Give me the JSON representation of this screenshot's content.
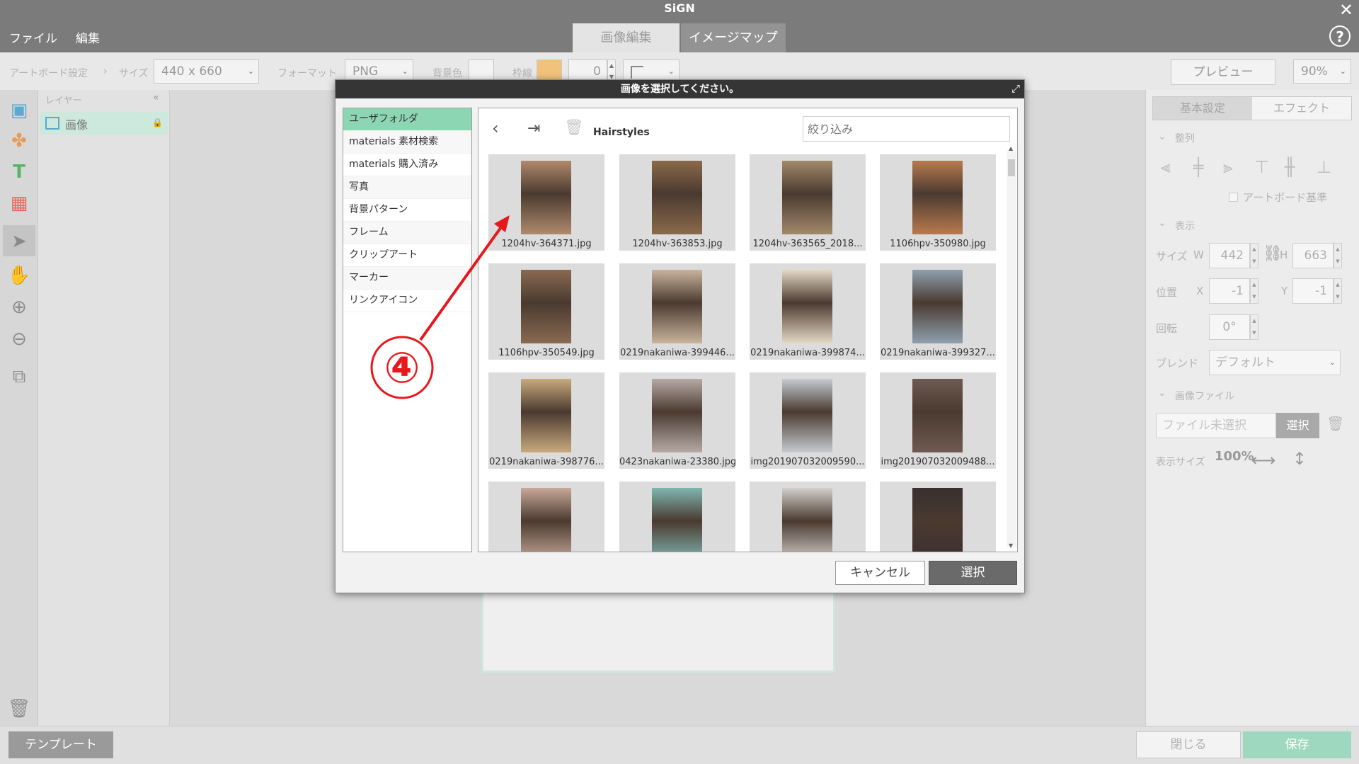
{
  "app": {
    "title": "SiGN",
    "menu": [
      "ファイル",
      "編集"
    ],
    "tabs": [
      "画像編集",
      "イメージマップ"
    ]
  },
  "toolbar": {
    "artboard_settings": "アートボード設定",
    "size_label": "サイズ",
    "size_value": "440 x 660",
    "format_label": "フォーマット",
    "format_value": "PNG",
    "bg_label": "背景色",
    "border_label": "枠線",
    "border_width": "0",
    "preview_button": "プレビュー",
    "zoom": "90%"
  },
  "layers": {
    "header": "レイヤー",
    "items": [
      {
        "label": "画像"
      }
    ]
  },
  "right_panel": {
    "tabs": [
      "基本設定",
      "エフェクト"
    ],
    "align_section": "整列",
    "artboard_basis": "アートボード基準",
    "display_section": "表示",
    "size_label": "サイズ",
    "w_label": "W",
    "w_value": "442",
    "h_label": "H",
    "h_value": "663",
    "pos_label": "位置",
    "x_label": "X",
    "x_value": "-1",
    "y_label": "Y",
    "y_value": "-1",
    "rotate_label": "回転",
    "rotate_value": "0°",
    "blend_label": "ブレンド",
    "blend_value": "デフォルト",
    "image_file_section": "画像ファイル",
    "file_placeholder": "ファイル未選択",
    "select_button": "選択",
    "display_size_label": "表示サイズ",
    "display_100": "100%"
  },
  "bottom": {
    "template_button": "テンプレート",
    "close_button": "閉じる",
    "save_button": "保存"
  },
  "dialog": {
    "title": "画像を選択してください。",
    "folders": [
      {
        "label": "ユーザフォルダ",
        "selected": true
      },
      {
        "label": "materials 素材検索"
      },
      {
        "label": "materials 購入済み"
      },
      {
        "label": "写真"
      },
      {
        "label": "背景パターン"
      },
      {
        "label": "フレーム"
      },
      {
        "label": "クリップアート"
      },
      {
        "label": "マーカー"
      },
      {
        "label": "リンクアイコン"
      }
    ],
    "current_folder": "Hairstyles",
    "filter_placeholder": "絞り込み",
    "images": [
      {
        "name": "1204hv-364371.jpg",
        "color": "#b08a6c"
      },
      {
        "name": "1204hv-363853.jpg",
        "color": "#8a6a4a"
      },
      {
        "name": "1204hv-363565_2018...",
        "color": "#a3896b"
      },
      {
        "name": "1106hpv-350980.jpg",
        "color": "#b87a4e"
      },
      {
        "name": "1106hpv-350549.jpg",
        "color": "#8a6a52"
      },
      {
        "name": "0219nakaniwa-399446...",
        "color": "#c9b49c"
      },
      {
        "name": "0219nakaniwa-399874...",
        "color": "#e6d9c6"
      },
      {
        "name": "0219nakaniwa-399327...",
        "color": "#8fa0ae"
      },
      {
        "name": "0219nakaniwa-398776...",
        "color": "#c9aa7d"
      },
      {
        "name": "0423nakaniwa-23380.jpg",
        "color": "#b7aaa6"
      },
      {
        "name": "img201907032009590...",
        "color": "#c5cbd1"
      },
      {
        "name": "img201907032009488...",
        "color": "#6e5a52"
      },
      {
        "name": "",
        "color": "#c9a99a"
      },
      {
        "name": "",
        "color": "#7fb7b1"
      },
      {
        "name": "",
        "color": "#d3d0cc"
      },
      {
        "name": "",
        "color": "#3a3030"
      }
    ],
    "cancel_button": "キャンセル",
    "select_button": "選択"
  },
  "annotation": {
    "step_marker": "④",
    "arrow_color": "#e8171c"
  }
}
